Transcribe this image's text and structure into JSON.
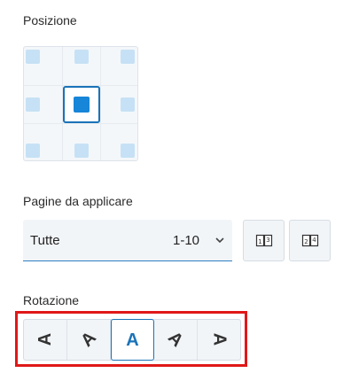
{
  "position": {
    "title": "Posizione",
    "selected": "center",
    "cells": [
      "top-left",
      "top-center",
      "top-right",
      "middle-left",
      "center",
      "middle-right",
      "bottom-left",
      "bottom-center",
      "bottom-right"
    ]
  },
  "pages": {
    "title": "Pagine da applicare",
    "selected_value": "Tutte",
    "range": "1-10",
    "odd_icon": "odd-pages-icon",
    "even_icon": "even-pages-icon"
  },
  "rotation": {
    "title": "Rotazione",
    "glyph": "A",
    "options": [
      {
        "name": "rotate-minus-90",
        "angle": -90
      },
      {
        "name": "rotate-minus-45",
        "angle": -45
      },
      {
        "name": "rotate-0",
        "angle": 0,
        "selected": true
      },
      {
        "name": "rotate-45",
        "angle": 45
      },
      {
        "name": "rotate-90",
        "angle": 90
      }
    ]
  },
  "colors": {
    "accent": "#1a73b8",
    "highlight": "#e01818"
  }
}
